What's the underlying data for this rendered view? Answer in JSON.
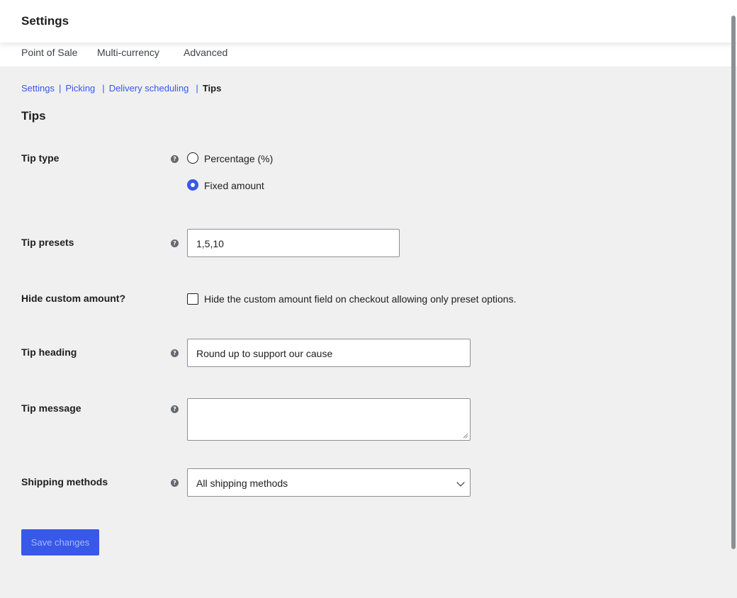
{
  "header": {
    "title": "Settings"
  },
  "tabs": [
    {
      "label": "Point of Sale"
    },
    {
      "label": "Multi-currency"
    },
    {
      "label": "Advanced"
    }
  ],
  "breadcrumb": {
    "items": [
      "Settings",
      "Picking",
      "Delivery scheduling"
    ],
    "separator": "|",
    "current": "Tips"
  },
  "section_title": "Tips",
  "help_glyph": "?",
  "fields": {
    "tip_type": {
      "label": "Tip type",
      "options": [
        {
          "label": "Percentage (%)",
          "checked": false
        },
        {
          "label": "Fixed amount",
          "checked": true
        }
      ]
    },
    "tip_presets": {
      "label": "Tip presets",
      "value": "1,5,10"
    },
    "hide_custom": {
      "label": "Hide custom amount?",
      "checkbox_label": "Hide the custom amount field on checkout allowing only preset options.",
      "checked": false
    },
    "tip_heading": {
      "label": "Tip heading",
      "value": "Round up to support our cause"
    },
    "tip_message": {
      "label": "Tip message",
      "value": ""
    },
    "shipping_methods": {
      "label": "Shipping methods",
      "selected": "All shipping methods"
    }
  },
  "save_label": "Save changes",
  "colors": {
    "accent": "#3858e9",
    "background": "#f0f0f1",
    "save_text": "#a8b8f6"
  },
  "icons": {
    "help": "help-icon",
    "select": "chevron-down-icon",
    "resize": "resize-handle-icon"
  }
}
